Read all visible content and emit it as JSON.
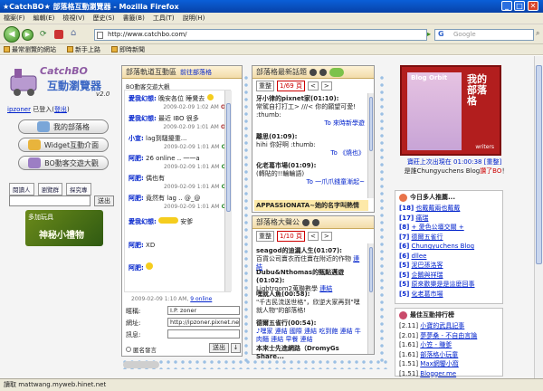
{
  "window": {
    "title": "★CatchBO★ 部落格互動瀏覽器 - Mozilla Firefox",
    "min": "_",
    "max": "□",
    "close": "✕"
  },
  "menu": [
    "檔案(F)",
    "編輯(E)",
    "檢視(V)",
    "歷史(S)",
    "書籤(B)",
    "工具(T)",
    "說明(H)"
  ],
  "nav": {
    "url": "http://www.catchbo.com/",
    "search_placeholder": "Google",
    "back": "◀",
    "forward": "▶",
    "go": "▶"
  },
  "bookmarks": [
    "最常瀏覽的網站",
    "新手上路",
    "即時新聞"
  ],
  "status": "讀取 mattwang.myweb.hinet.net",
  "left": {
    "logo_word": "CatchBO",
    "logo_sub": "互動瀏覽器",
    "version": "v2.0",
    "username": "ipzoner",
    "user_mid": " 已登入(",
    "logout": "登出",
    "user_end": ")",
    "buttons": [
      "我的部落格",
      "Widget互動介面",
      "BO動客交遊大觀"
    ],
    "small_buttons": [
      "閱讀人",
      "瀏覽群",
      "探究專"
    ],
    "go_btn": "送出",
    "banner_top": "多加玩具",
    "banner_big": "神秘小禮物"
  },
  "chat": {
    "title": "部落軌道互動區",
    "title_link": "前往部落格",
    "list_title": "BO動客交遊大觀",
    "rows": [
      {
        "name": "愛我幻想:",
        "text": "晚安各位 睡覺去",
        "time": "2009-02-09 1:02 AM",
        "status": "Off"
      },
      {
        "name": "愛我幻想:",
        "text": "最近 IBO 很多",
        "time": "2009-02-09 1:01 AM",
        "status": "Off"
      },
      {
        "name": "小宣:",
        "text": "lag到騷擾重...",
        "time": "2009-02-09 1:01 AM",
        "status": "On"
      },
      {
        "name": "阿肥:",
        "text": "26 online .. 一一a",
        "time": "2009-02-09 1:01 AM",
        "status": "On"
      },
      {
        "name": "阿肥:",
        "text": "偶也有",
        "time": "2009-02-09 1:01 AM",
        "status": "On"
      },
      {
        "name": "阿肥:",
        "text": "竟然有 lag .. @_@",
        "time": "2009-02-09 1:01 AM",
        "status": "On"
      },
      {
        "name": "愛我幻想:",
        "text": "安爹",
        "time": "",
        "status": ""
      },
      {
        "name": "阿肥:",
        "text": "XD",
        "time": "",
        "status": ""
      },
      {
        "name": "阿肥:",
        "text": "",
        "time": "",
        "status": ""
      }
    ],
    "footer_time": "2009-02-09 1:10 AM,",
    "footer_online": "9 online",
    "form_labels": [
      "暱稱:",
      "網址:",
      "訊息:"
    ],
    "nick_value": "I.P. zoner",
    "url_value": "http://ipzoner.pixnet.net/b",
    "hide_label": "匿名發言",
    "submit": "送出",
    "clear": "↓"
  },
  "topics": {
    "title": "部落格最新話題",
    "pager": {
      "reload": "重整",
      "page": "1/69 頁",
      "prev": "<",
      "next": ">"
    },
    "posts": [
      {
        "title": "牙小律的pixnet家(01:10):",
        "body": "常駕自打打工> ///< 你的願望可愛!",
        "body2": ":thumb:",
        "to": "To 來時新學遊"
      },
      {
        "title": "離思(01:09):",
        "body": "hihi 你好啊 :thumb:",
        "body2": "",
        "to": "To 《燒也》"
      },
      {
        "title": "化老葛市場(01:09):",
        "body": "(轉貼的!!輪輪語)",
        "body2": "",
        "to": "To 一爪爪錢童漸起~"
      }
    ],
    "highlight": "APPASSIONATA~她的名字叫熱情"
  },
  "hot": {
    "title": "部落格大聲公",
    "pager": {
      "reload": "重整",
      "page": "1/10 頁",
      "prev": "<",
      "next": ">"
    },
    "posts": [
      {
        "title": "seagod的迪漏人生(01:07):",
        "body": "百貨公司賣衣而住賣在附近的作物",
        "link": "連結"
      },
      {
        "title": "Dubu&Nthomas的甄點邁遊(01:02):",
        "body": "Lightroom2蒐聯數學",
        "link": "連結"
      },
      {
        "title": "嘿就人魚(00:58):",
        "body": "\"千古民流送世格\"，欣逆大家再到\"嘿就人物\"的部落格!",
        "link": ""
      },
      {
        "title": "德爾五雀行(00:54):",
        "body": "♪嘿家 連結 國際 連結 吃到飽 連結 牛肉麵 連結 早餐 連結",
        "link": ""
      },
      {
        "title": "本來士先進網路（DromyGs Share...",
        "body": "",
        "link": ""
      }
    ]
  },
  "right": {
    "ad_blog": "Blog Orbit",
    "ad_vert": "我的部落格",
    "ad_writers": "writers",
    "ad_last": "寶莊上次出現在 01:00:38",
    "ad_reload": "[重整]",
    "ad_welcome_pre": "是誰Chungyuchens Blog",
    "ad_welcome_link": "讚了BO",
    "ad_welcome_end": "！",
    "popular_title": "今日多人推薦...",
    "popular": [
      {
        "count": "[18]",
        "text": "也戴戴兩也戴戴"
      },
      {
        "count": "[17]",
        "text": "痛瑞"
      },
      {
        "count": "[8]",
        "text": "+ 愛色公壇交關 +"
      },
      {
        "count": "[7]",
        "text": "德爾五雀行"
      },
      {
        "count": "[6]",
        "text": "Chungyuchens Blog"
      },
      {
        "count": "[6]",
        "text": "dllee"
      },
      {
        "count": "[5]",
        "text": "泥巴孫洛客"
      },
      {
        "count": "[5]",
        "text": "企鵝與祥瑞"
      },
      {
        "count": "[5]",
        "text": "原來歡樂是是這麼回事"
      },
      {
        "count": "[5]",
        "text": "化老葛市場"
      }
    ],
    "rank_title": "最佳互動排行榜",
    "rank": [
      {
        "count": "[2.11]",
        "text": "小寶的武具記事"
      },
      {
        "count": "[2.01]",
        "text": "夢夢桑 - 不自由言論"
      },
      {
        "count": "[1.61]",
        "text": "小笠 - 賺爹"
      },
      {
        "count": "[1.61]",
        "text": "部落格小玩童"
      },
      {
        "count": "[1.51]",
        "text": "Max網鑒小窩"
      },
      {
        "count": "[1.51]",
        "text": "Blogger.me"
      }
    ]
  },
  "colors": {
    "accent": "#0a5fd8",
    "panel_title_bg": "#f2dcaa",
    "link": "#0022cc",
    "ad_red": "#b21e1e"
  }
}
